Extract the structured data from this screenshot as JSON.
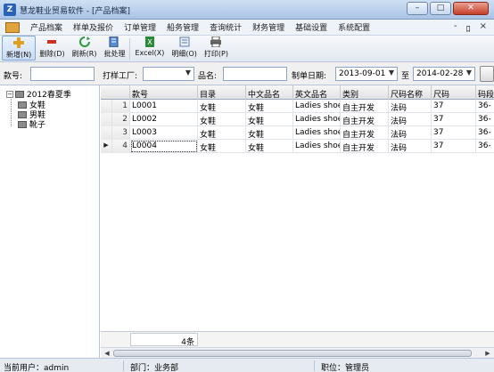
{
  "window": {
    "title": "慧龙鞋业贸易软件 - [产品档案]",
    "controls": {
      "minimize": "–",
      "maximize": "□",
      "close": "✕"
    }
  },
  "menu": {
    "items": [
      "产品档案",
      "样单及报价",
      "订单管理",
      "船务管理",
      "查询统计",
      "财务管理",
      "基础设置",
      "系统配置"
    ],
    "mdi": {
      "minimize": "-",
      "restore": "ﾛ",
      "close": "×"
    }
  },
  "toolbar": {
    "buttons": [
      {
        "label": "新增(N)",
        "icon": "plus-icon"
      },
      {
        "label": "删除(D)",
        "icon": "minus-icon"
      },
      {
        "label": "刷新(R)",
        "icon": "refresh-icon"
      },
      {
        "label": "批处理",
        "icon": "batch-icon"
      },
      {
        "label": "Excel(X)",
        "icon": "excel-icon"
      },
      {
        "label": "明细(O)",
        "icon": "detail-icon"
      },
      {
        "label": "打印(P)",
        "icon": "printer-icon"
      }
    ]
  },
  "filters": {
    "style_no_label": "款号:",
    "factory_label": "打样工厂:",
    "name_label": "品名:",
    "date_label": "制单日期:",
    "date_from": "2013-09-01",
    "date_to_label": "至",
    "date_to": "2014-02-28"
  },
  "tree": {
    "root": "2012春夏季",
    "children": [
      "女鞋",
      "男鞋",
      "靴子"
    ]
  },
  "grid": {
    "columns": [
      "款号",
      "目录",
      "中文品名",
      "英文品名",
      "类别",
      "尺码名称",
      "尺码",
      "码段"
    ],
    "rows": [
      {
        "num": "1",
        "cells": [
          "L0001",
          "女鞋",
          "女鞋",
          "Ladies shoes",
          "自主开发",
          "法码",
          "37",
          "36-"
        ]
      },
      {
        "num": "2",
        "cells": [
          "L0002",
          "女鞋",
          "女鞋",
          "Ladies shoes",
          "自主开发",
          "法码",
          "37",
          "36-"
        ]
      },
      {
        "num": "3",
        "cells": [
          "L0003",
          "女鞋",
          "女鞋",
          "Ladies shoes",
          "自主开发",
          "法码",
          "37",
          "36-"
        ]
      },
      {
        "num": "4",
        "cells": [
          "L0004",
          "女鞋",
          "女鞋",
          "Ladies shoes",
          "自主开发",
          "法码",
          "37",
          "36-"
        ]
      }
    ],
    "current_row_indicator": "▶",
    "summary_count": "4条"
  },
  "status": {
    "user": "当前用户：admin",
    "dept": "部门：业务部",
    "position": "职位：管理员"
  },
  "colors": {
    "accent": "#2a62b8",
    "close_button": "#c5402a",
    "window_background": "#c8d6e8"
  }
}
